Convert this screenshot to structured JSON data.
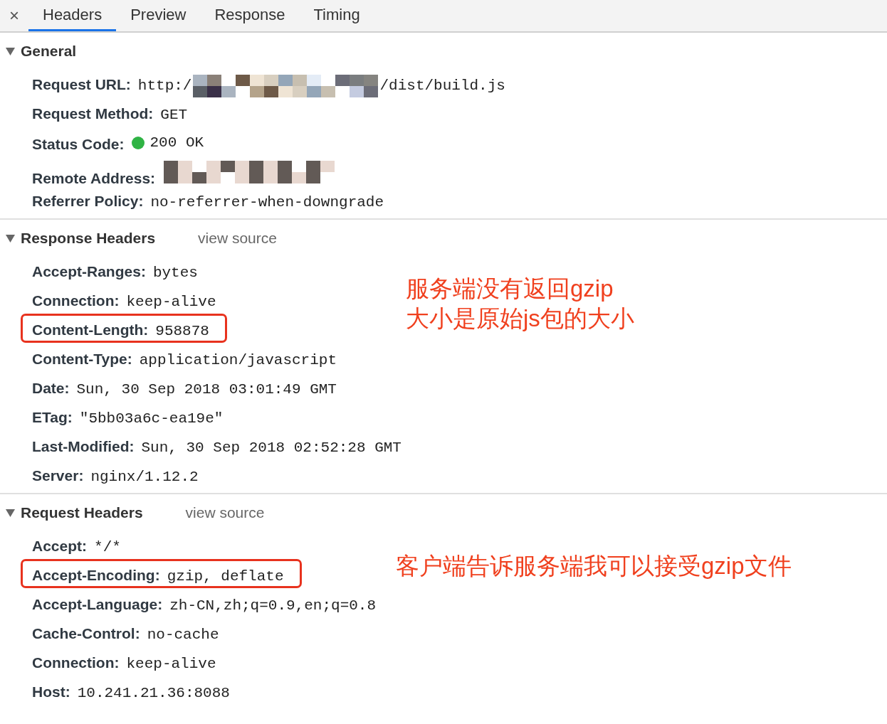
{
  "tabs": [
    {
      "label": "Headers",
      "selected": true
    },
    {
      "label": "Preview",
      "selected": false
    },
    {
      "label": "Response",
      "selected": false
    },
    {
      "label": "Timing",
      "selected": false
    }
  ],
  "close_label": "×",
  "sections": [
    {
      "title": "General",
      "expanded": true,
      "rows": [
        {
          "kind": "redacted",
          "name": "Request URL:",
          "value": "http:/",
          "value_after": "/dist/build.js",
          "highlighted": false
        },
        {
          "kind": "text",
          "name": "Request Method:",
          "value": "GET",
          "highlighted": false
        },
        {
          "kind": "status",
          "name": "Status Code:",
          "value": "200 OK",
          "color": "#2fb344",
          "highlighted": false
        },
        {
          "kind": "redacted",
          "name": "Remote Address:",
          "highlighted": false
        },
        {
          "kind": "text",
          "name": "Referrer Policy:",
          "value": "no-referrer-when-downgrade",
          "highlighted": false
        }
      ]
    },
    {
      "title": "Response Headers",
      "expanded": true,
      "link": "view source",
      "note": [
        "服务端没有返回gzip",
        "大小是原始js包的大小"
      ],
      "rows": [
        {
          "kind": "text",
          "name": "Accept-Ranges:",
          "value": "bytes",
          "highlighted": false
        },
        {
          "kind": "text",
          "name": "Connection:",
          "value": "keep-alive",
          "highlighted": false
        },
        {
          "kind": "text",
          "name": "Content-Length:",
          "value": "958878",
          "highlighted": true
        },
        {
          "kind": "text",
          "name": "Content-Type:",
          "value": "application/javascript",
          "highlighted": false
        },
        {
          "kind": "text",
          "name": "Date:",
          "value": "Sun, 30 Sep 2018 03:01:49 GMT",
          "highlighted": false
        },
        {
          "kind": "text",
          "name": "ETag:",
          "value": "\"5bb03a6c-ea19e\"",
          "highlighted": false
        },
        {
          "kind": "text",
          "name": "Last-Modified:",
          "value": "Sun, 30 Sep 2018 02:52:28 GMT",
          "highlighted": false
        },
        {
          "kind": "text",
          "name": "Server:",
          "value": "nginx/1.12.2",
          "highlighted": false
        }
      ]
    },
    {
      "title": "Request Headers",
      "expanded": true,
      "link": "view source",
      "note": [
        "客户端告诉服务端我可以接受gzip文件"
      ],
      "rows": [
        {
          "kind": "text",
          "name": "Accept:",
          "value": "*/*",
          "highlighted": false
        },
        {
          "kind": "text",
          "name": "Accept-Encoding:",
          "value": "gzip, deflate",
          "highlighted": true
        },
        {
          "kind": "text",
          "name": "Accept-Language:",
          "value": "zh-CN,zh;q=0.9,en;q=0.8",
          "highlighted": false
        },
        {
          "kind": "text",
          "name": "Cache-Control:",
          "value": "no-cache",
          "highlighted": false
        },
        {
          "kind": "text",
          "name": "Connection:",
          "value": "keep-alive",
          "highlighted": false
        },
        {
          "kind": "text",
          "name": "Host:",
          "value": "10.241.21.36:8088",
          "highlighted": false
        }
      ]
    }
  ]
}
